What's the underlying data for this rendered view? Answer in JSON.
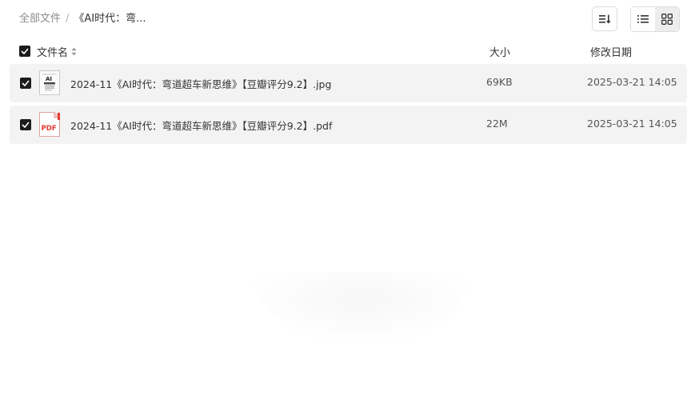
{
  "breadcrumb": {
    "root": "全部文件",
    "separator": "/",
    "current": "《AI时代：弯..."
  },
  "toolbar": {
    "sort_icon": "sort-icon",
    "list_view_icon": "list-view-icon",
    "grid_view_icon": "grid-view-icon"
  },
  "table": {
    "columns": {
      "name": "文件名",
      "size": "大小",
      "date": "修改日期"
    },
    "rows": [
      {
        "name": "2024-11《AI时代：弯道超车新思维》【豆瓣评分9.2】.jpg",
        "size": "69KB",
        "date": "2025-03-21 14:05",
        "type_icon": "image-thumbnail-icon",
        "checked": true
      },
      {
        "name": "2024-11《AI时代：弯道超车新思维》【豆瓣评分9.2】.pdf",
        "size": "22M",
        "date": "2025-03-21 14:05",
        "type_icon": "pdf-file-icon",
        "checked": true
      }
    ]
  },
  "colors": {
    "checkbox": "#1c1c1c",
    "row_background": "#f3f3f3",
    "pdf_red": "#e53935"
  }
}
